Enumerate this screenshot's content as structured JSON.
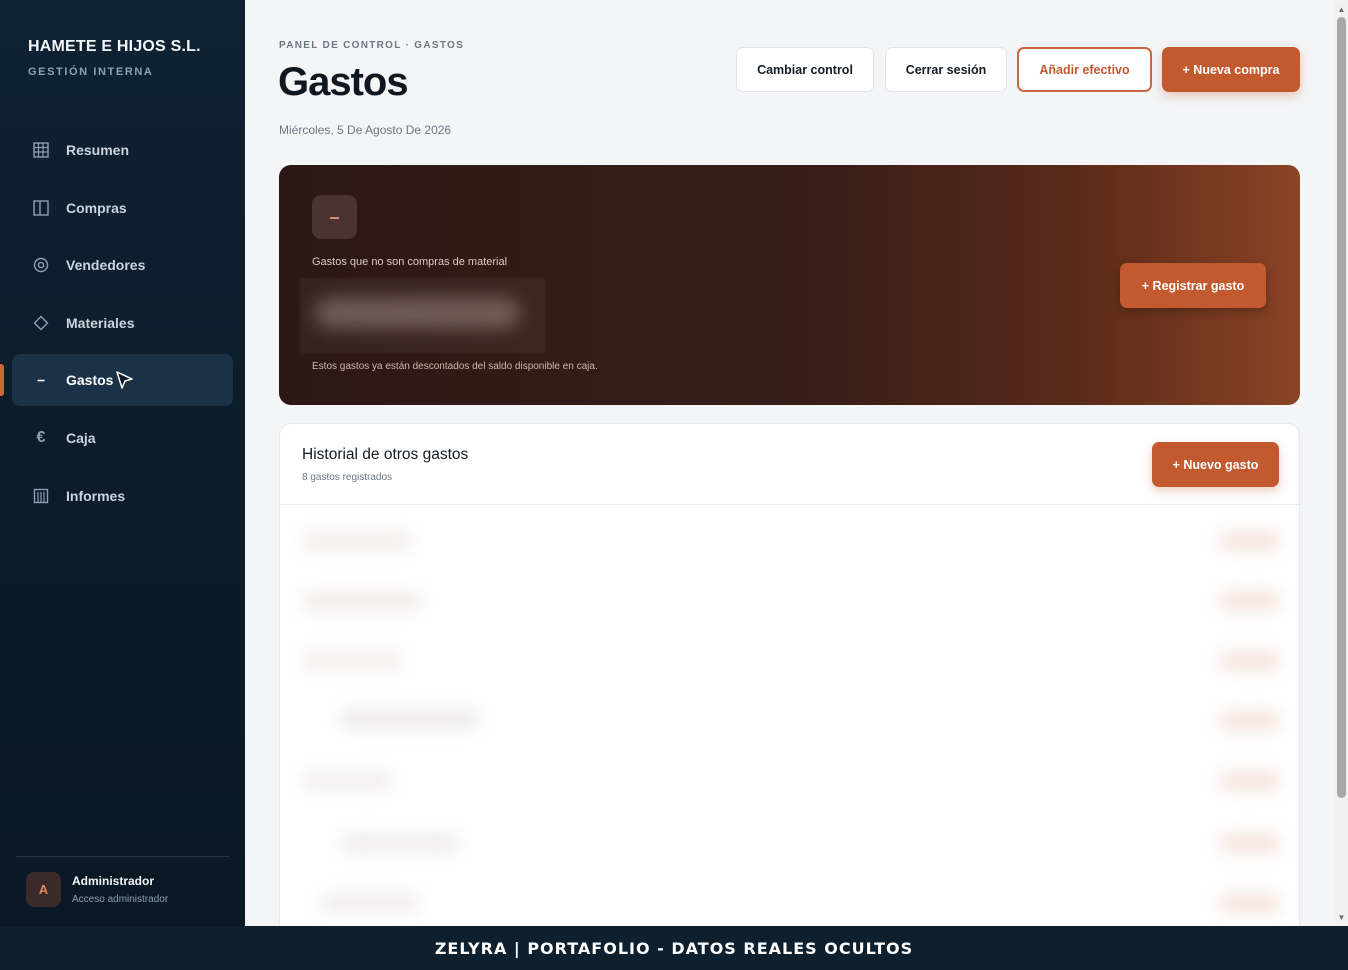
{
  "sidebar": {
    "brand_title": "HAMETE E HIJOS S.L.",
    "brand_subtitle": "GESTIÓN INTERNA",
    "items": [
      {
        "label": "Resumen",
        "icon": "grid-icon"
      },
      {
        "label": "Compras",
        "icon": "columns-icon"
      },
      {
        "label": "Vendedores",
        "icon": "target-icon"
      },
      {
        "label": "Materiales",
        "icon": "diamond-icon"
      },
      {
        "label": "Gastos",
        "icon": "minus-icon",
        "active": true
      },
      {
        "label": "Caja",
        "icon": "euro-icon"
      },
      {
        "label": "Informes",
        "icon": "report-icon"
      }
    ],
    "user": {
      "initial": "A",
      "name": "Administrador",
      "role": "Acceso administrador"
    }
  },
  "header": {
    "breadcrumb": "PANEL DE CONTROL · GASTOS",
    "title": "Gastos",
    "date": "Miércoles, 5 De Agosto De 2026",
    "buttons": {
      "change_control": "Cambiar control",
      "logout": "Cerrar sesión",
      "add_cash": "Añadir efectivo",
      "new_purchase": "+ Nueva compra"
    }
  },
  "hero": {
    "icon": "minus-icon",
    "icon_glyph": "–",
    "label": "Gastos que no son compras de material",
    "note": "Estos gastos ya están descontados del saldo disponible en caja.",
    "button": "+ Registrar gasto"
  },
  "history": {
    "title": "Historial de otros gastos",
    "subtitle": "8 gastos registrados",
    "button": "+ Nuevo gasto"
  },
  "footer": {
    "text": "ZELYRA | PORTAFOLIO - DATOS REALES OCULTOS"
  },
  "colors": {
    "accent": "#c35a2f",
    "sidebar_bg": "#0c1c2b",
    "hero_dark": "#2b1715",
    "hero_light": "#8b4325"
  }
}
